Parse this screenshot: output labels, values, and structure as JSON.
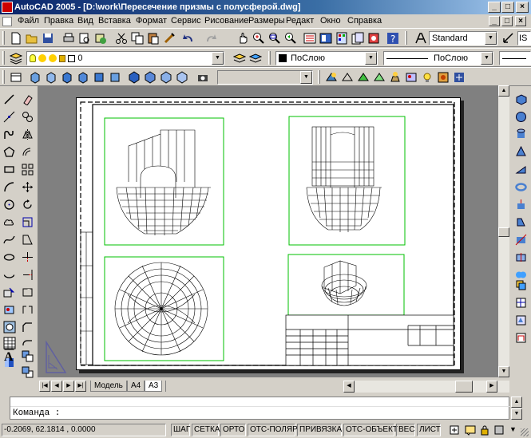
{
  "window": {
    "title": "AutoCAD 2005 - [D:\\work\\Пересечение призмы с полусферой.dwg]"
  },
  "window_buttons": {
    "minimize": "_",
    "maximize": "□",
    "close": "×"
  },
  "menu": [
    "Файл",
    "Правка",
    "Вид",
    "Вставка",
    "Формат",
    "Сервис",
    "Рисование",
    "Размеры",
    "Редакт",
    "Окно",
    "Справка"
  ],
  "toolbar": {
    "text_style": "Standard",
    "dim_style_partial": "IS",
    "layer": "0",
    "color": "ПоСлою",
    "linetype": "ПоСлою"
  },
  "tabs": [
    "Модель",
    "A4",
    "A3"
  ],
  "active_tab": "A3",
  "command": {
    "prompt": "Команда :"
  },
  "status": {
    "coords": "-0.2069, 62.1814 , 0.0000",
    "toggles": [
      "ШАГ",
      "СЕТКА",
      "ОРТО",
      "ОТС-ПОЛЯР",
      "ПРИВЯЗКА",
      "ОТС-ОБЪЕКТ",
      "ВЕС",
      "ЛИСТ"
    ]
  },
  "colors": {
    "viewport_border": "#00c000",
    "canvas_bg": "#808080",
    "title_bar": "#0a246a"
  }
}
